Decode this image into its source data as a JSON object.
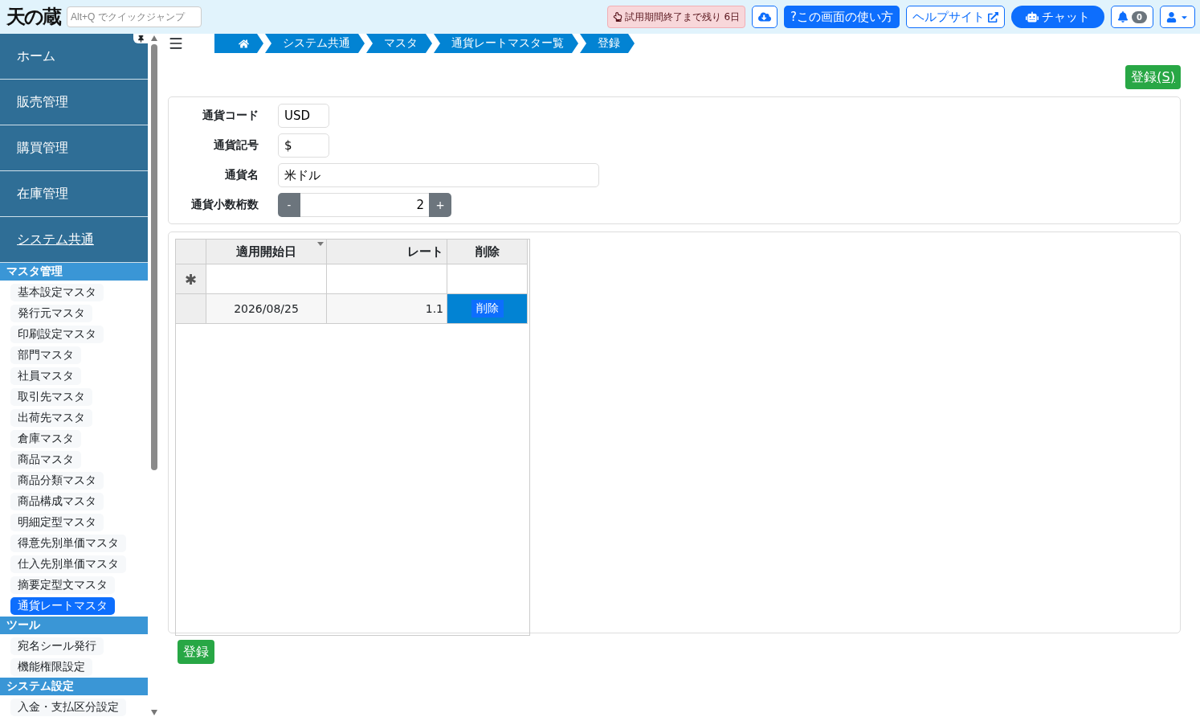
{
  "header": {
    "logo": "天の蔵",
    "quick_jump": {
      "placeholder": "Alt+Q でクイックジャンプ"
    },
    "trial_notice": "試用期間終了まで残り 6日",
    "help_button": "?この画面の使い方",
    "help_site_link": "ヘルプサイト",
    "chat_button": "チャット",
    "notification_count": "0"
  },
  "sidebar": {
    "main_items": [
      {
        "label": "ホーム",
        "selected": false
      },
      {
        "label": "販売管理",
        "selected": false
      },
      {
        "label": "購買管理",
        "selected": false
      },
      {
        "label": "在庫管理",
        "selected": false
      },
      {
        "label": "システム共通",
        "selected": true
      }
    ],
    "sections": [
      {
        "title": "マスタ管理",
        "items": [
          {
            "label": "基本設定マスタ",
            "selected": false
          },
          {
            "label": "発行元マスタ",
            "selected": false
          },
          {
            "label": "印刷設定マスタ",
            "selected": false
          },
          {
            "label": "部門マスタ",
            "selected": false
          },
          {
            "label": "社員マスタ",
            "selected": false
          },
          {
            "label": "取引先マスタ",
            "selected": false
          },
          {
            "label": "出荷先マスタ",
            "selected": false
          },
          {
            "label": "倉庫マスタ",
            "selected": false
          },
          {
            "label": "商品マスタ",
            "selected": false
          },
          {
            "label": "商品分類マスタ",
            "selected": false
          },
          {
            "label": "商品構成マスタ",
            "selected": false
          },
          {
            "label": "明細定型マスタ",
            "selected": false
          },
          {
            "label": "得意先別単価マスタ",
            "selected": false
          },
          {
            "label": "仕入先別単価マスタ",
            "selected": false
          },
          {
            "label": "摘要定型文マスタ",
            "selected": false
          },
          {
            "label": "通貨レートマスタ",
            "selected": true
          }
        ]
      },
      {
        "title": "ツール",
        "items": [
          {
            "label": "宛名シール発行",
            "selected": false
          },
          {
            "label": "機能権限設定",
            "selected": false
          }
        ]
      },
      {
        "title": "システム設定",
        "items": [
          {
            "label": "入金・支払区分設定",
            "selected": false
          }
        ]
      }
    ]
  },
  "breadcrumb": [
    "システム共通",
    "マスタ",
    "通貨レートマスター覧",
    "登録"
  ],
  "top_save_button": {
    "label": "登録",
    "shortcut": "(S)"
  },
  "form": {
    "fields": [
      {
        "label": "通貨コード",
        "value": "USD",
        "kind": "short"
      },
      {
        "label": "通貨記号",
        "value": "$",
        "kind": "short"
      },
      {
        "label": "通貨名",
        "value": "米ドル",
        "kind": "long"
      },
      {
        "label": "通貨小数桁数",
        "value": "2",
        "kind": "stepper",
        "minus": "-",
        "plus": "+"
      }
    ]
  },
  "grid": {
    "columns": [
      "適用開始日",
      "レート",
      "削除"
    ],
    "new_row_marker": "✱",
    "rows": [
      {
        "start_date": "2026/08/25",
        "rate": "1.1",
        "delete": "削除",
        "selected": true
      }
    ]
  },
  "bottom_save_button": "登録"
}
